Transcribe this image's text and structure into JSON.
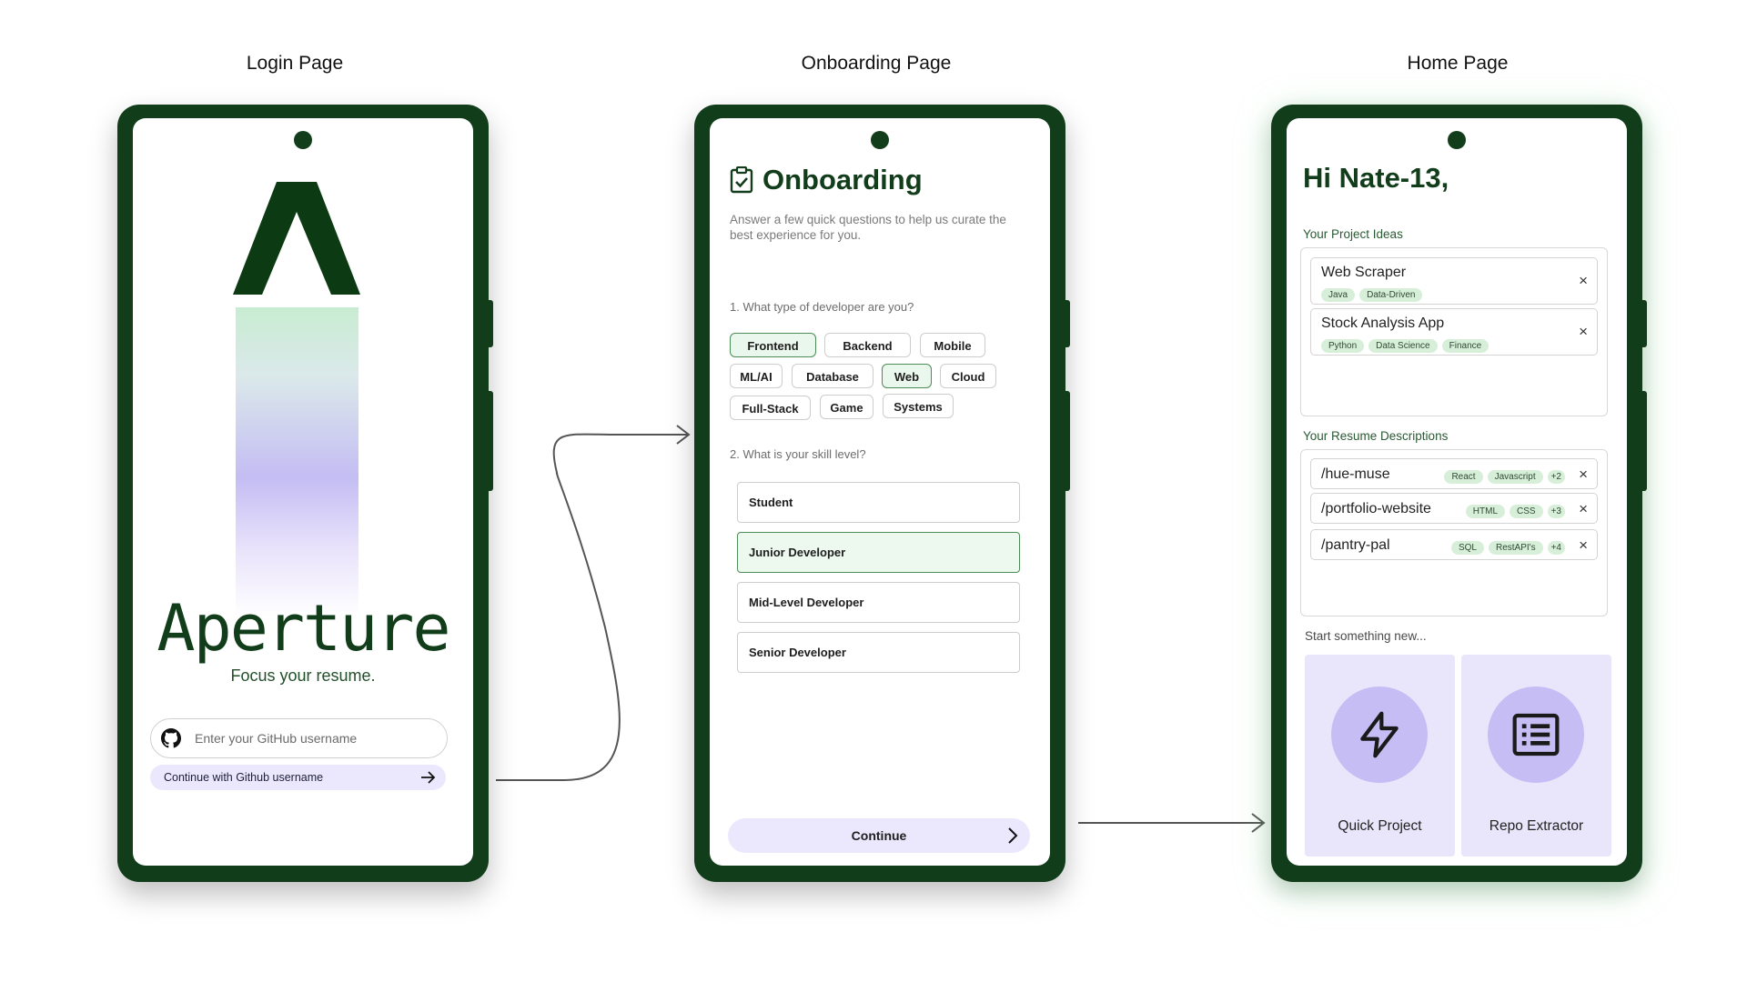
{
  "captions": {
    "login": "Login Page",
    "onboarding": "Onboarding Page",
    "home": "Home Page"
  },
  "login": {
    "brand": "Aperture",
    "tagline": "Focus your resume.",
    "github_placeholder": "Enter your GitHub username",
    "continue_label": "Continue with Github username",
    "icons": [
      "github-icon",
      "arrow-right-icon"
    ]
  },
  "onboarding": {
    "title": "Onboarding",
    "subtitle": "Answer a few quick questions to help us curate the best experience for you.",
    "question1": "1. What type of developer are you?",
    "dev_types": [
      {
        "label": "Frontend",
        "selected": true
      },
      {
        "label": "Backend",
        "selected": false
      },
      {
        "label": "Mobile",
        "selected": false
      },
      {
        "label": "ML/AI",
        "selected": false
      },
      {
        "label": "Database",
        "selected": false
      },
      {
        "label": "Web",
        "selected": true
      },
      {
        "label": "Cloud",
        "selected": false
      },
      {
        "label": "Full-Stack",
        "selected": false
      },
      {
        "label": "Game",
        "selected": false
      },
      {
        "label": "Systems",
        "selected": false
      }
    ],
    "question2": "2. What is your skill level?",
    "levels": [
      {
        "label": "Student",
        "selected": false
      },
      {
        "label": "Junior Developer",
        "selected": true
      },
      {
        "label": "Mid-Level Developer",
        "selected": false
      },
      {
        "label": "Senior Developer",
        "selected": false
      }
    ],
    "continue_label": "Continue",
    "icons": [
      "clipboard-check-icon",
      "chevron-right-icon"
    ]
  },
  "home": {
    "greeting": "Hi Nate-13,",
    "project_ideas_label": "Your Project Ideas",
    "project_ideas": [
      {
        "name": "Web Scraper",
        "tags": [
          "Java",
          "Data-Driven"
        ]
      },
      {
        "name": "Stock Analysis App",
        "tags": [
          "Python",
          "Data Science",
          "Finance"
        ]
      }
    ],
    "resume_label": "Your Resume Descriptions",
    "resume_descriptions": [
      {
        "name": "/hue-muse",
        "tags": [
          "React",
          "Javascript",
          "+2"
        ]
      },
      {
        "name": "/portfolio-website",
        "tags": [
          "HTML",
          "CSS",
          "+3"
        ]
      },
      {
        "name": "/pantry-pal",
        "tags": [
          "SQL",
          "RestAPI's",
          "+4"
        ]
      }
    ],
    "start_label": "Start something new...",
    "tiles": [
      {
        "label": "Quick Project",
        "icon": "lightning-bolt-icon"
      },
      {
        "label": "Repo Extractor",
        "icon": "list-document-icon"
      }
    ],
    "remove_glyph": "×"
  },
  "colors": {
    "brand_dark_green": "#123d1a",
    "accent_lavender": "#ebe8fd",
    "tag_green": "#d7efd9",
    "selected_green_bg": "#eaf7ec"
  }
}
